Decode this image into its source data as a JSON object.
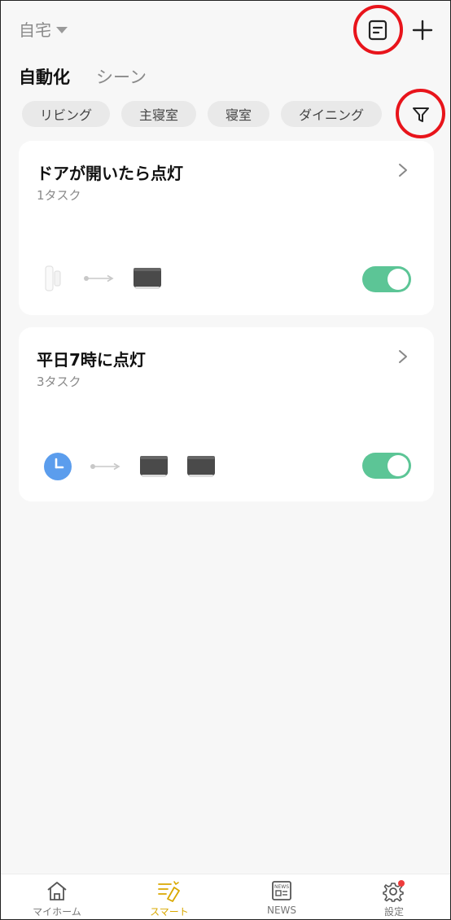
{
  "header": {
    "home_name": "自宅"
  },
  "tabs": [
    {
      "label": "自動化",
      "active": true
    },
    {
      "label": "シーン",
      "active": false
    }
  ],
  "room_filters": [
    "リビング",
    "主寝室",
    "寝室",
    "ダイニング"
  ],
  "automations": [
    {
      "title": "ドアが開いたら点灯",
      "task_count": "1タスク",
      "trigger_icon": "door-sensor-icon",
      "action_icons": [
        "ceiling-light-icon"
      ],
      "enabled": true
    },
    {
      "title": "平日7時に点灯",
      "task_count": "3タスク",
      "trigger_icon": "clock-icon",
      "action_icons": [
        "ceiling-light-icon",
        "ceiling-light-icon"
      ],
      "enabled": true
    }
  ],
  "bottom_nav": [
    {
      "label": "マイホーム",
      "icon": "home-icon",
      "active": false
    },
    {
      "label": "スマート",
      "icon": "smart-icon",
      "active": true
    },
    {
      "label": "NEWS",
      "icon": "news-icon",
      "active": false
    },
    {
      "label": "設定",
      "icon": "gear-icon",
      "active": false,
      "badge": true
    }
  ],
  "colors": {
    "accent": "#d9a800",
    "toggle_on": "#5cc596",
    "highlight_ring": "#e8141b",
    "background": "#f7f7f7"
  }
}
